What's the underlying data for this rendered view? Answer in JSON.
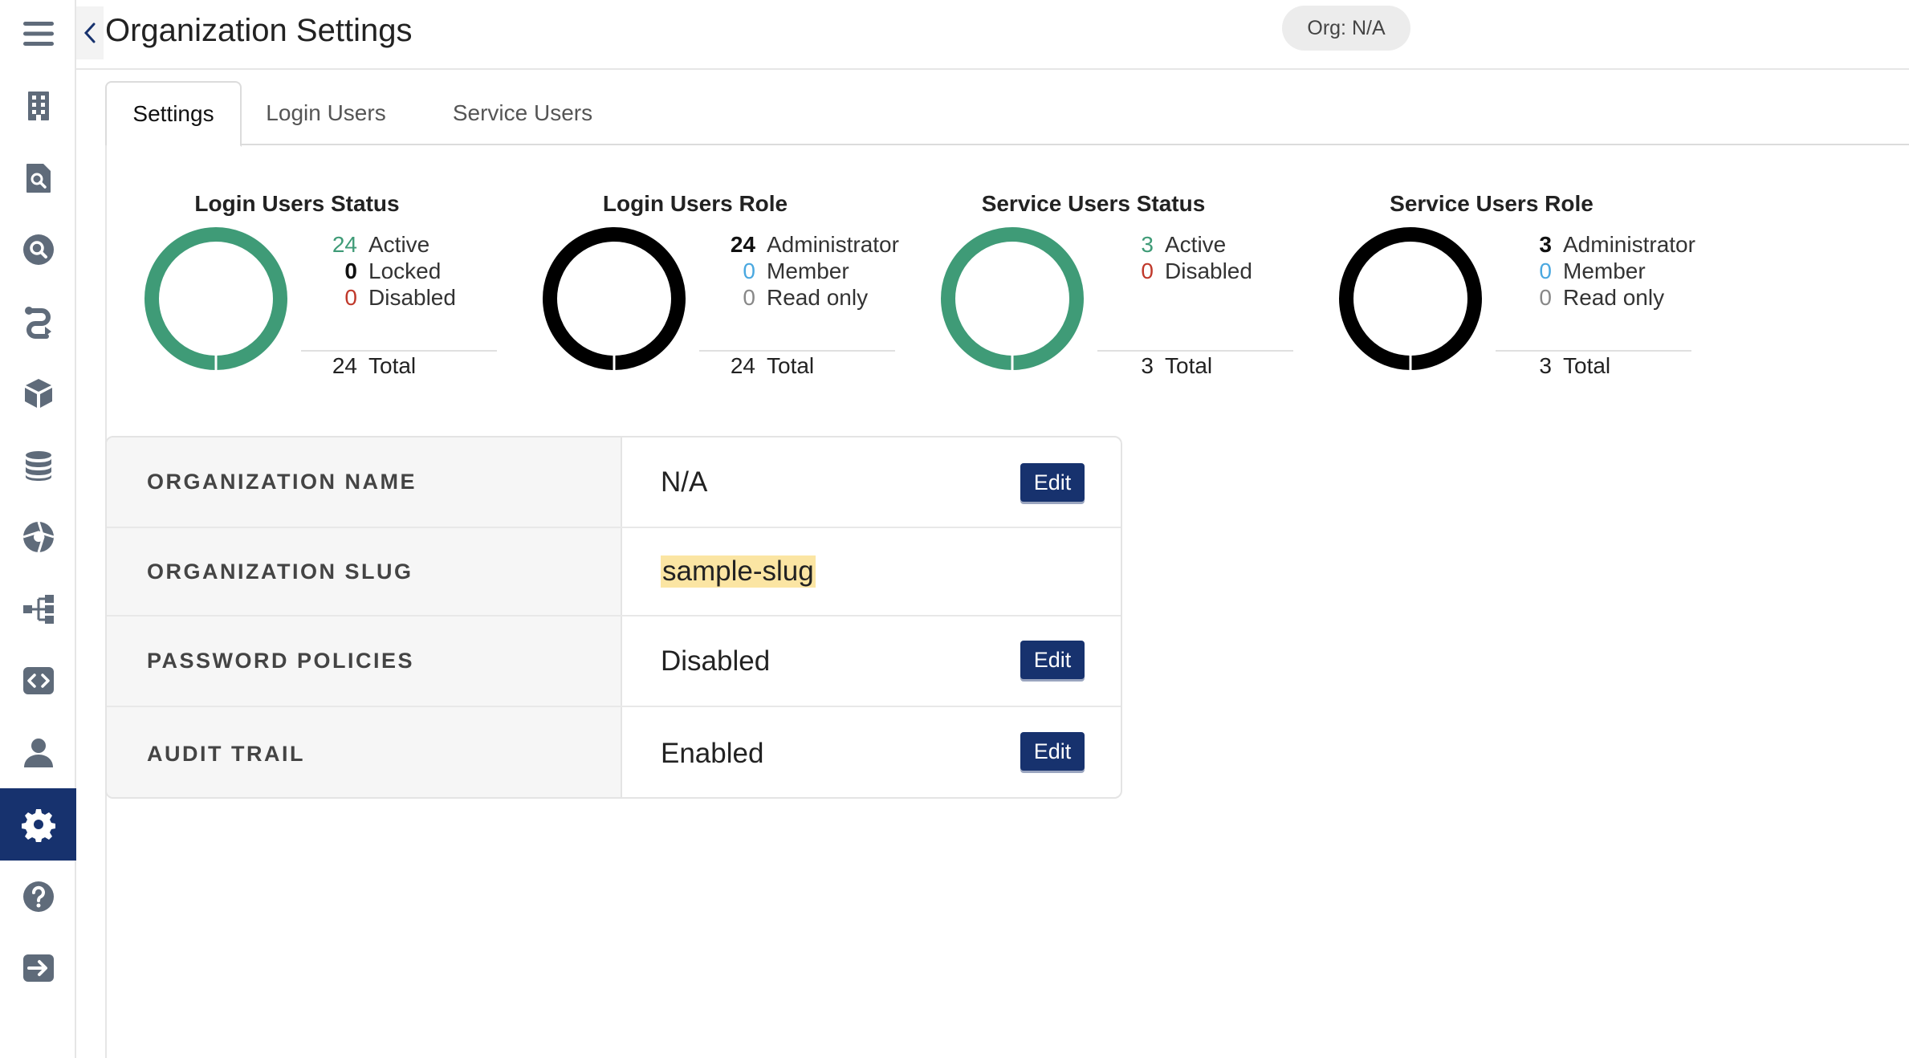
{
  "header": {
    "back_icon": "chevron-left-icon",
    "title": "Organization Settings",
    "org_badge": "Org: N/A"
  },
  "sidebar": {
    "menu_icon": "hamburger-menu-icon",
    "items": [
      {
        "icon": "building-icon"
      },
      {
        "icon": "document-search-icon"
      },
      {
        "icon": "search-icon"
      },
      {
        "icon": "pipeline-icon"
      },
      {
        "icon": "cube-icon"
      },
      {
        "icon": "database-icon"
      },
      {
        "icon": "aperture-icon"
      },
      {
        "icon": "hierarchy-icon"
      },
      {
        "icon": "code-icon"
      },
      {
        "icon": "user-icon"
      },
      {
        "icon": "gear-icon",
        "active": true
      },
      {
        "icon": "help-icon"
      },
      {
        "icon": "logout-icon"
      }
    ]
  },
  "tabs": [
    {
      "label": "Settings",
      "active": true
    },
    {
      "label": "Login Users"
    },
    {
      "label": "Service Users"
    }
  ],
  "stats": [
    {
      "title": "Login Users Status",
      "ring_color": "#3f9b77",
      "rows": [
        {
          "value": "24",
          "label": "Active",
          "color": "#3f9b77"
        },
        {
          "value": "0",
          "label": "Locked",
          "color": "#111111"
        },
        {
          "value": "0",
          "label": "Disabled",
          "color": "#c0392b"
        }
      ],
      "total_value": "24",
      "total_label": "Total"
    },
    {
      "title": "Login Users Role",
      "ring_color": "#000000",
      "rows": [
        {
          "value": "24",
          "label": "Administrator",
          "color": "#111111"
        },
        {
          "value": "0",
          "label": "Member",
          "color": "#4aa8e0"
        },
        {
          "value": "0",
          "label": "Read only",
          "color": "#888888"
        }
      ],
      "total_value": "24",
      "total_label": "Total"
    },
    {
      "title": "Service Users Status",
      "ring_color": "#3f9b77",
      "rows": [
        {
          "value": "3",
          "label": "Active",
          "color": "#3f9b77"
        },
        {
          "value": "0",
          "label": "Disabled",
          "color": "#c0392b"
        }
      ],
      "total_value": "3",
      "total_label": "Total"
    },
    {
      "title": "Service Users Role",
      "ring_color": "#000000",
      "rows": [
        {
          "value": "3",
          "label": "Administrator",
          "color": "#111111"
        },
        {
          "value": "0",
          "label": "Member",
          "color": "#4aa8e0"
        },
        {
          "value": "0",
          "label": "Read only",
          "color": "#888888"
        }
      ],
      "total_value": "3",
      "total_label": "Total"
    }
  ],
  "settings": [
    {
      "label": "ORGANIZATION NAME",
      "value": "N/A",
      "edit_label": "Edit"
    },
    {
      "label": "ORGANIZATION SLUG",
      "value": "sample-slug",
      "highlight": true
    },
    {
      "label": "PASSWORD POLICIES",
      "value": "Disabled",
      "edit_label": "Edit"
    },
    {
      "label": "AUDIT TRAIL",
      "value": "Enabled",
      "edit_label": "Edit"
    }
  ],
  "colors": {
    "accent": "#17326e",
    "green": "#3f9b77",
    "red": "#c0392b",
    "blue": "#4aa8e0",
    "icon_gray": "#5f6b7a"
  }
}
